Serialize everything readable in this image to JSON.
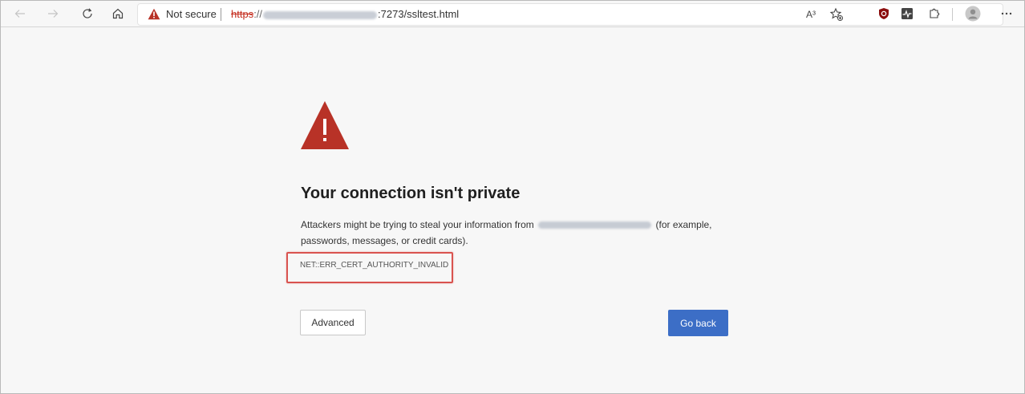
{
  "toolbar": {
    "back_icon": "arrow-left-icon",
    "forward_icon": "arrow-right-icon",
    "refresh_icon": "refresh-icon",
    "home_icon": "home-icon"
  },
  "address_bar": {
    "security_label": "Not secure",
    "url_scheme": "https",
    "url_separator": "://",
    "url_port_path": ":7273/ssltest.html",
    "read_aloud_label": "A³"
  },
  "page": {
    "heading": "Your connection isn't private",
    "description_before": "Attackers might be trying to steal your information from",
    "description_after": "(for example, passwords, messages, or credit cards).",
    "error_code": "NET::ERR_CERT_AUTHORITY_INVALID",
    "advanced_label": "Advanced",
    "go_back_label": "Go back"
  },
  "colors": {
    "warning": "#b83227",
    "primary_button": "#3c6ec6",
    "highlight_box": "#d9534f"
  }
}
